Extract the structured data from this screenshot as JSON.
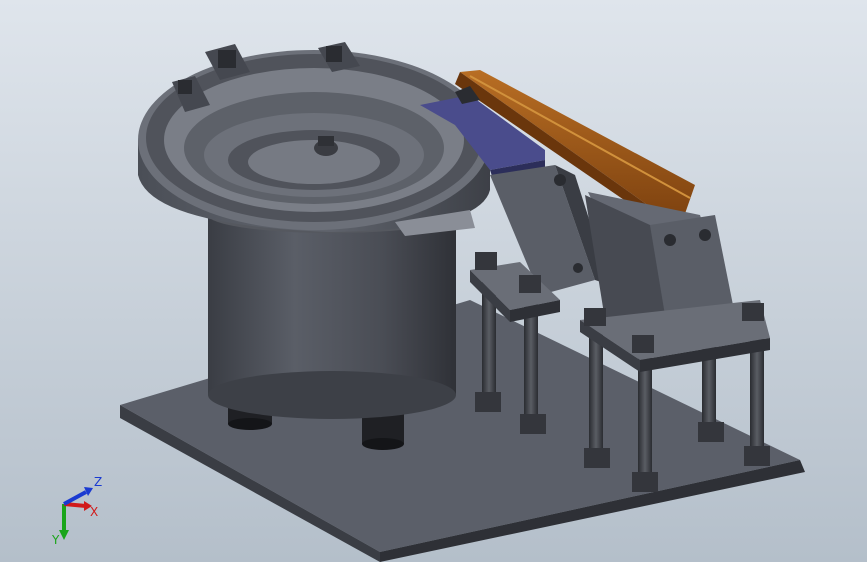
{
  "viewport": {
    "background_top": "#dde3ea",
    "background_bottom": "#b8c2cd"
  },
  "model": {
    "body_color": "#4c5058",
    "body_dark": "#2e3036",
    "base_color": "#5a5e68",
    "track_color": "#8a4a12",
    "track_light": "#b26a22",
    "guide_color": "#3c3f7a"
  },
  "triad": {
    "x_label": "X",
    "y_label": "Y",
    "z_label": "Z",
    "x_color": "#d11a1a",
    "y_color": "#1aa51a",
    "z_color": "#1a3ad1"
  }
}
